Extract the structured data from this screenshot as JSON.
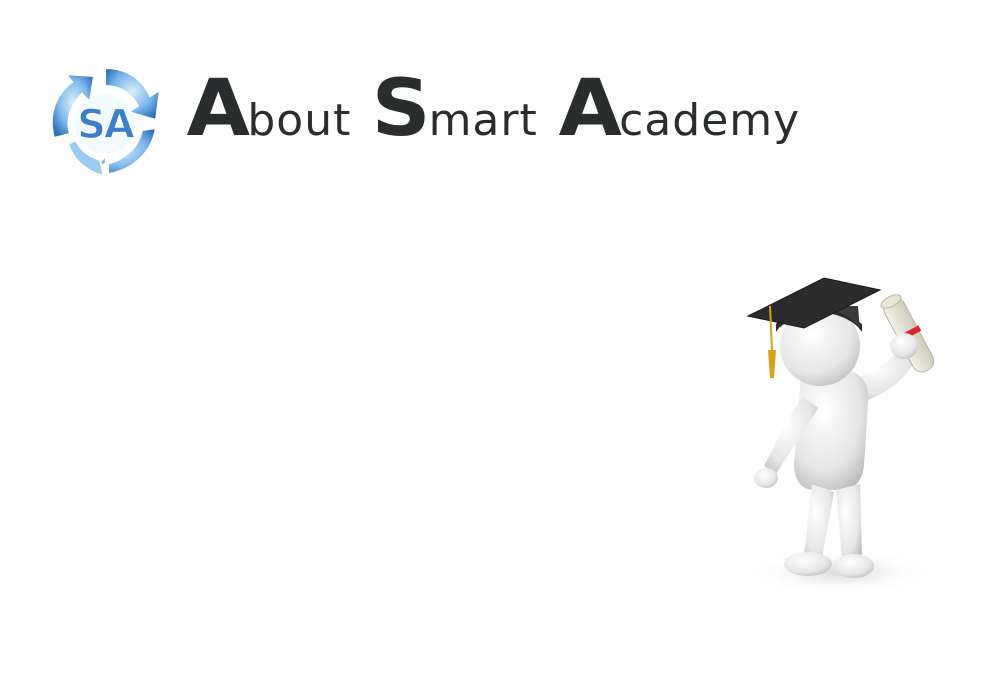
{
  "logo": {
    "text": "SA",
    "colors": {
      "primary": "#3a7fc8",
      "light": "#8fc3ee",
      "arrow_fill": "#6aaee6"
    }
  },
  "title": {
    "words": [
      {
        "cap": "A",
        "rest": "bout"
      },
      {
        "cap": "S",
        "rest": "mart"
      },
      {
        "cap": "A",
        "rest": "cademy"
      }
    ],
    "color": "#2a2d2e"
  },
  "figure": {
    "icon": "graduate-figure-icon",
    "cap_color": "#2b2b2b",
    "tassel_color": "#d9a21b",
    "ribbon_color": "#d62a2a"
  }
}
